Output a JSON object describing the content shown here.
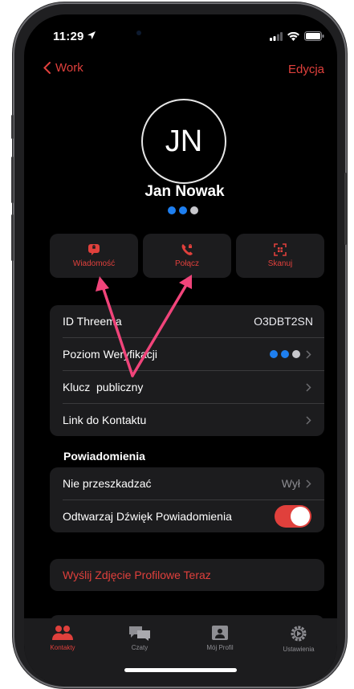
{
  "status": {
    "time": "11:29"
  },
  "nav": {
    "back_label": "Work",
    "edit_label": "Edycja"
  },
  "contact": {
    "initials": "JN",
    "name": "Jan Nowak"
  },
  "colors": {
    "accent": "#e0403c",
    "verified": "#1e7ff0",
    "unverified": "#c7c7cc"
  },
  "actions": [
    {
      "label": "Wiadomość",
      "icon": "message-icon"
    },
    {
      "label": "Połącz",
      "icon": "phone-icon"
    },
    {
      "label": "Skanuj",
      "icon": "qr-scan-icon"
    }
  ],
  "details": {
    "threema_id_label": "ID Threema",
    "threema_id_value": "O3DBT2SN",
    "verification_label": "Poziom Weryfikacji",
    "public_key_label": "Klucz  publiczny",
    "contact_link_label": "Link do Kontaktu"
  },
  "notifications": {
    "header": "Powiadomienia",
    "dnd_label": "Nie przeszkadzać",
    "dnd_value": "Wył",
    "sound_label": "Odtwarzaj Dźwięk Powiadomienia",
    "sound_on": true
  },
  "profile_photo": {
    "send_label": "Wyślij Zdjęcie Profilowe Teraz"
  },
  "tabs": [
    {
      "label": "Kontakty",
      "icon": "contacts-icon",
      "active": true
    },
    {
      "label": "Czaty",
      "icon": "chats-icon",
      "active": false
    },
    {
      "label": "Mój Profil",
      "icon": "profile-icon",
      "active": false
    },
    {
      "label": "Ustawienia",
      "icon": "settings-icon",
      "active": false
    }
  ]
}
